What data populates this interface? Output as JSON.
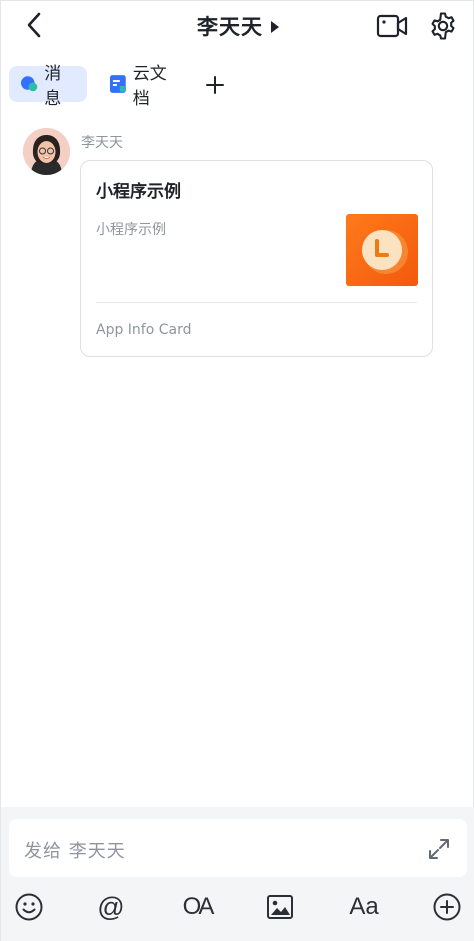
{
  "header": {
    "title": "李天天",
    "back_icon": "chevron-left-icon",
    "video_icon": "video-call-icon",
    "settings_icon": "gear-icon"
  },
  "tabs": [
    {
      "label": "消息",
      "icon": "chat-bubble-icon",
      "active": true
    },
    {
      "label": "云文档",
      "icon": "doc-icon",
      "active": false
    }
  ],
  "add_tab_icon": "plus-icon",
  "message": {
    "sender": "李天天",
    "card": {
      "title": "小程序示例",
      "description": "小程序示例",
      "footer": "App Info Card",
      "thumb_icon": "clock-app-icon"
    }
  },
  "input": {
    "placeholder": "发给 李天天",
    "expand_icon": "expand-icon"
  },
  "toolbar": {
    "items": [
      {
        "name": "emoji",
        "icon": "smile-icon"
      },
      {
        "name": "mention",
        "icon": "at-icon",
        "text": "@"
      },
      {
        "name": "ok",
        "text": "OA"
      },
      {
        "name": "image",
        "icon": "image-icon"
      },
      {
        "name": "font",
        "text": "Aa"
      },
      {
        "name": "more",
        "icon": "plus-circle-icon"
      }
    ]
  },
  "colors": {
    "accent": "#3370ff",
    "tab_active_bg": "#e1eaff",
    "thumb_orange": "#f25a0c",
    "bottom_bg": "#f4f5f7"
  }
}
